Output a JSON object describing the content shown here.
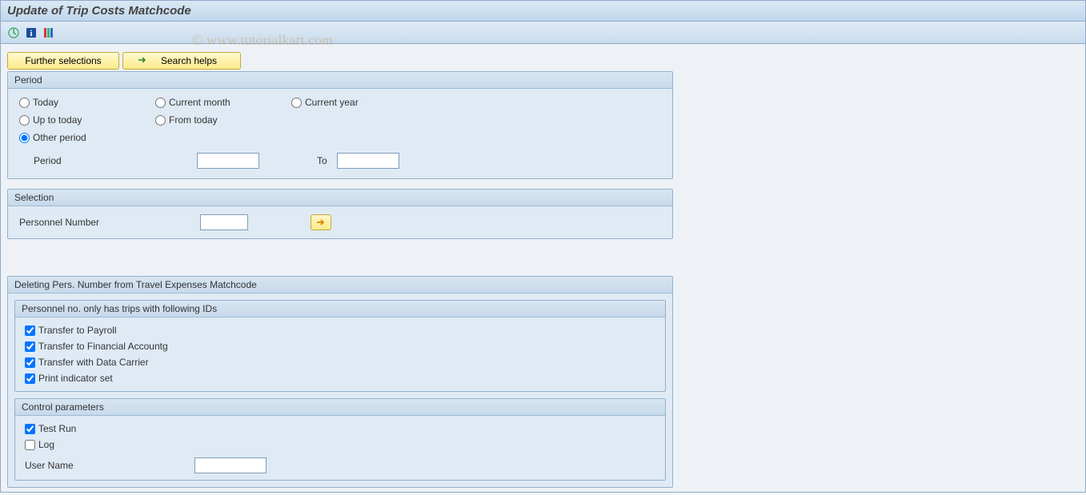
{
  "title": "Update of Trip Costs Matchcode",
  "watermark": "© www.tutorialkart.com",
  "toolbar": {
    "icons": [
      "execute-icon",
      "info-icon",
      "palette-icon"
    ]
  },
  "buttons": {
    "further_selections": "Further selections",
    "search_helps": "Search helps"
  },
  "period": {
    "title": "Period",
    "options": {
      "today": "Today",
      "current_month": "Current month",
      "current_year": "Current year",
      "up_to_today": "Up to today",
      "from_today": "From today",
      "other_period": "Other period"
    },
    "selected": "other_period",
    "period_label": "Period",
    "to_label": "To",
    "from_value": "",
    "to_value": ""
  },
  "selection": {
    "title": "Selection",
    "personnel_number_label": "Personnel Number",
    "personnel_number_value": ""
  },
  "deleting": {
    "title": "Deleting Pers. Number from Travel Expenses Matchcode",
    "trips_ids": {
      "title": "Personnel no. only has trips with following IDs",
      "transfer_payroll": {
        "label": "Transfer to Payroll",
        "checked": true
      },
      "transfer_fin": {
        "label": "Transfer to Financial Accountg",
        "checked": true
      },
      "transfer_carrier": {
        "label": "Transfer with Data Carrier",
        "checked": true
      },
      "print_indicator": {
        "label": "Print indicator set",
        "checked": true
      }
    },
    "control": {
      "title": "Control parameters",
      "test_run": {
        "label": "Test Run",
        "checked": true
      },
      "log": {
        "label": "Log",
        "checked": false
      },
      "user_name_label": "User Name",
      "user_name_value": ""
    }
  }
}
